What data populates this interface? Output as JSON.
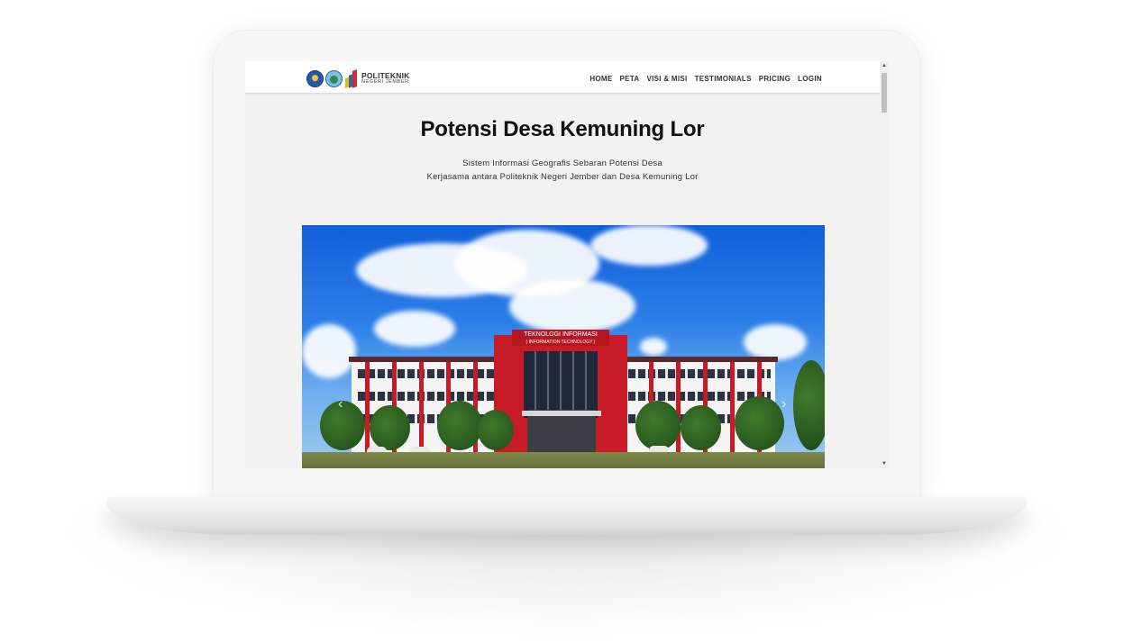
{
  "brand": {
    "logo_title": "POLITEKNIK",
    "logo_sub": "NEGERI JEMBER",
    "logo_icons": [
      "tut-wuri-handayani-icon",
      "jember-regency-icon",
      "polije-icon"
    ]
  },
  "nav": {
    "items": [
      "HOME",
      "PETA",
      "VISI & MISI",
      "TESTIMONIALS",
      "PRICING",
      "LOGIN"
    ]
  },
  "hero": {
    "title": "Potensi Desa Kemuning Lor",
    "subtitle_line1": "Sistem Informasi Geografis Sebaran Potensi Desa",
    "subtitle_line2": "Kerjasama antara Politeknik Negeri Jember dan Desa Kemuning Lor"
  },
  "carousel": {
    "sign_line1": "TEKNOLOGI INFORMASI",
    "sign_line2": "( INFORMATION TECHNOLOGY )",
    "prev_icon": "chevron-left-icon",
    "next_icon": "chevron-right-icon"
  },
  "colors": {
    "accent_red": "#c81b26",
    "sky_blue": "#2c7fe8",
    "page_bg": "#f2f2f2"
  }
}
